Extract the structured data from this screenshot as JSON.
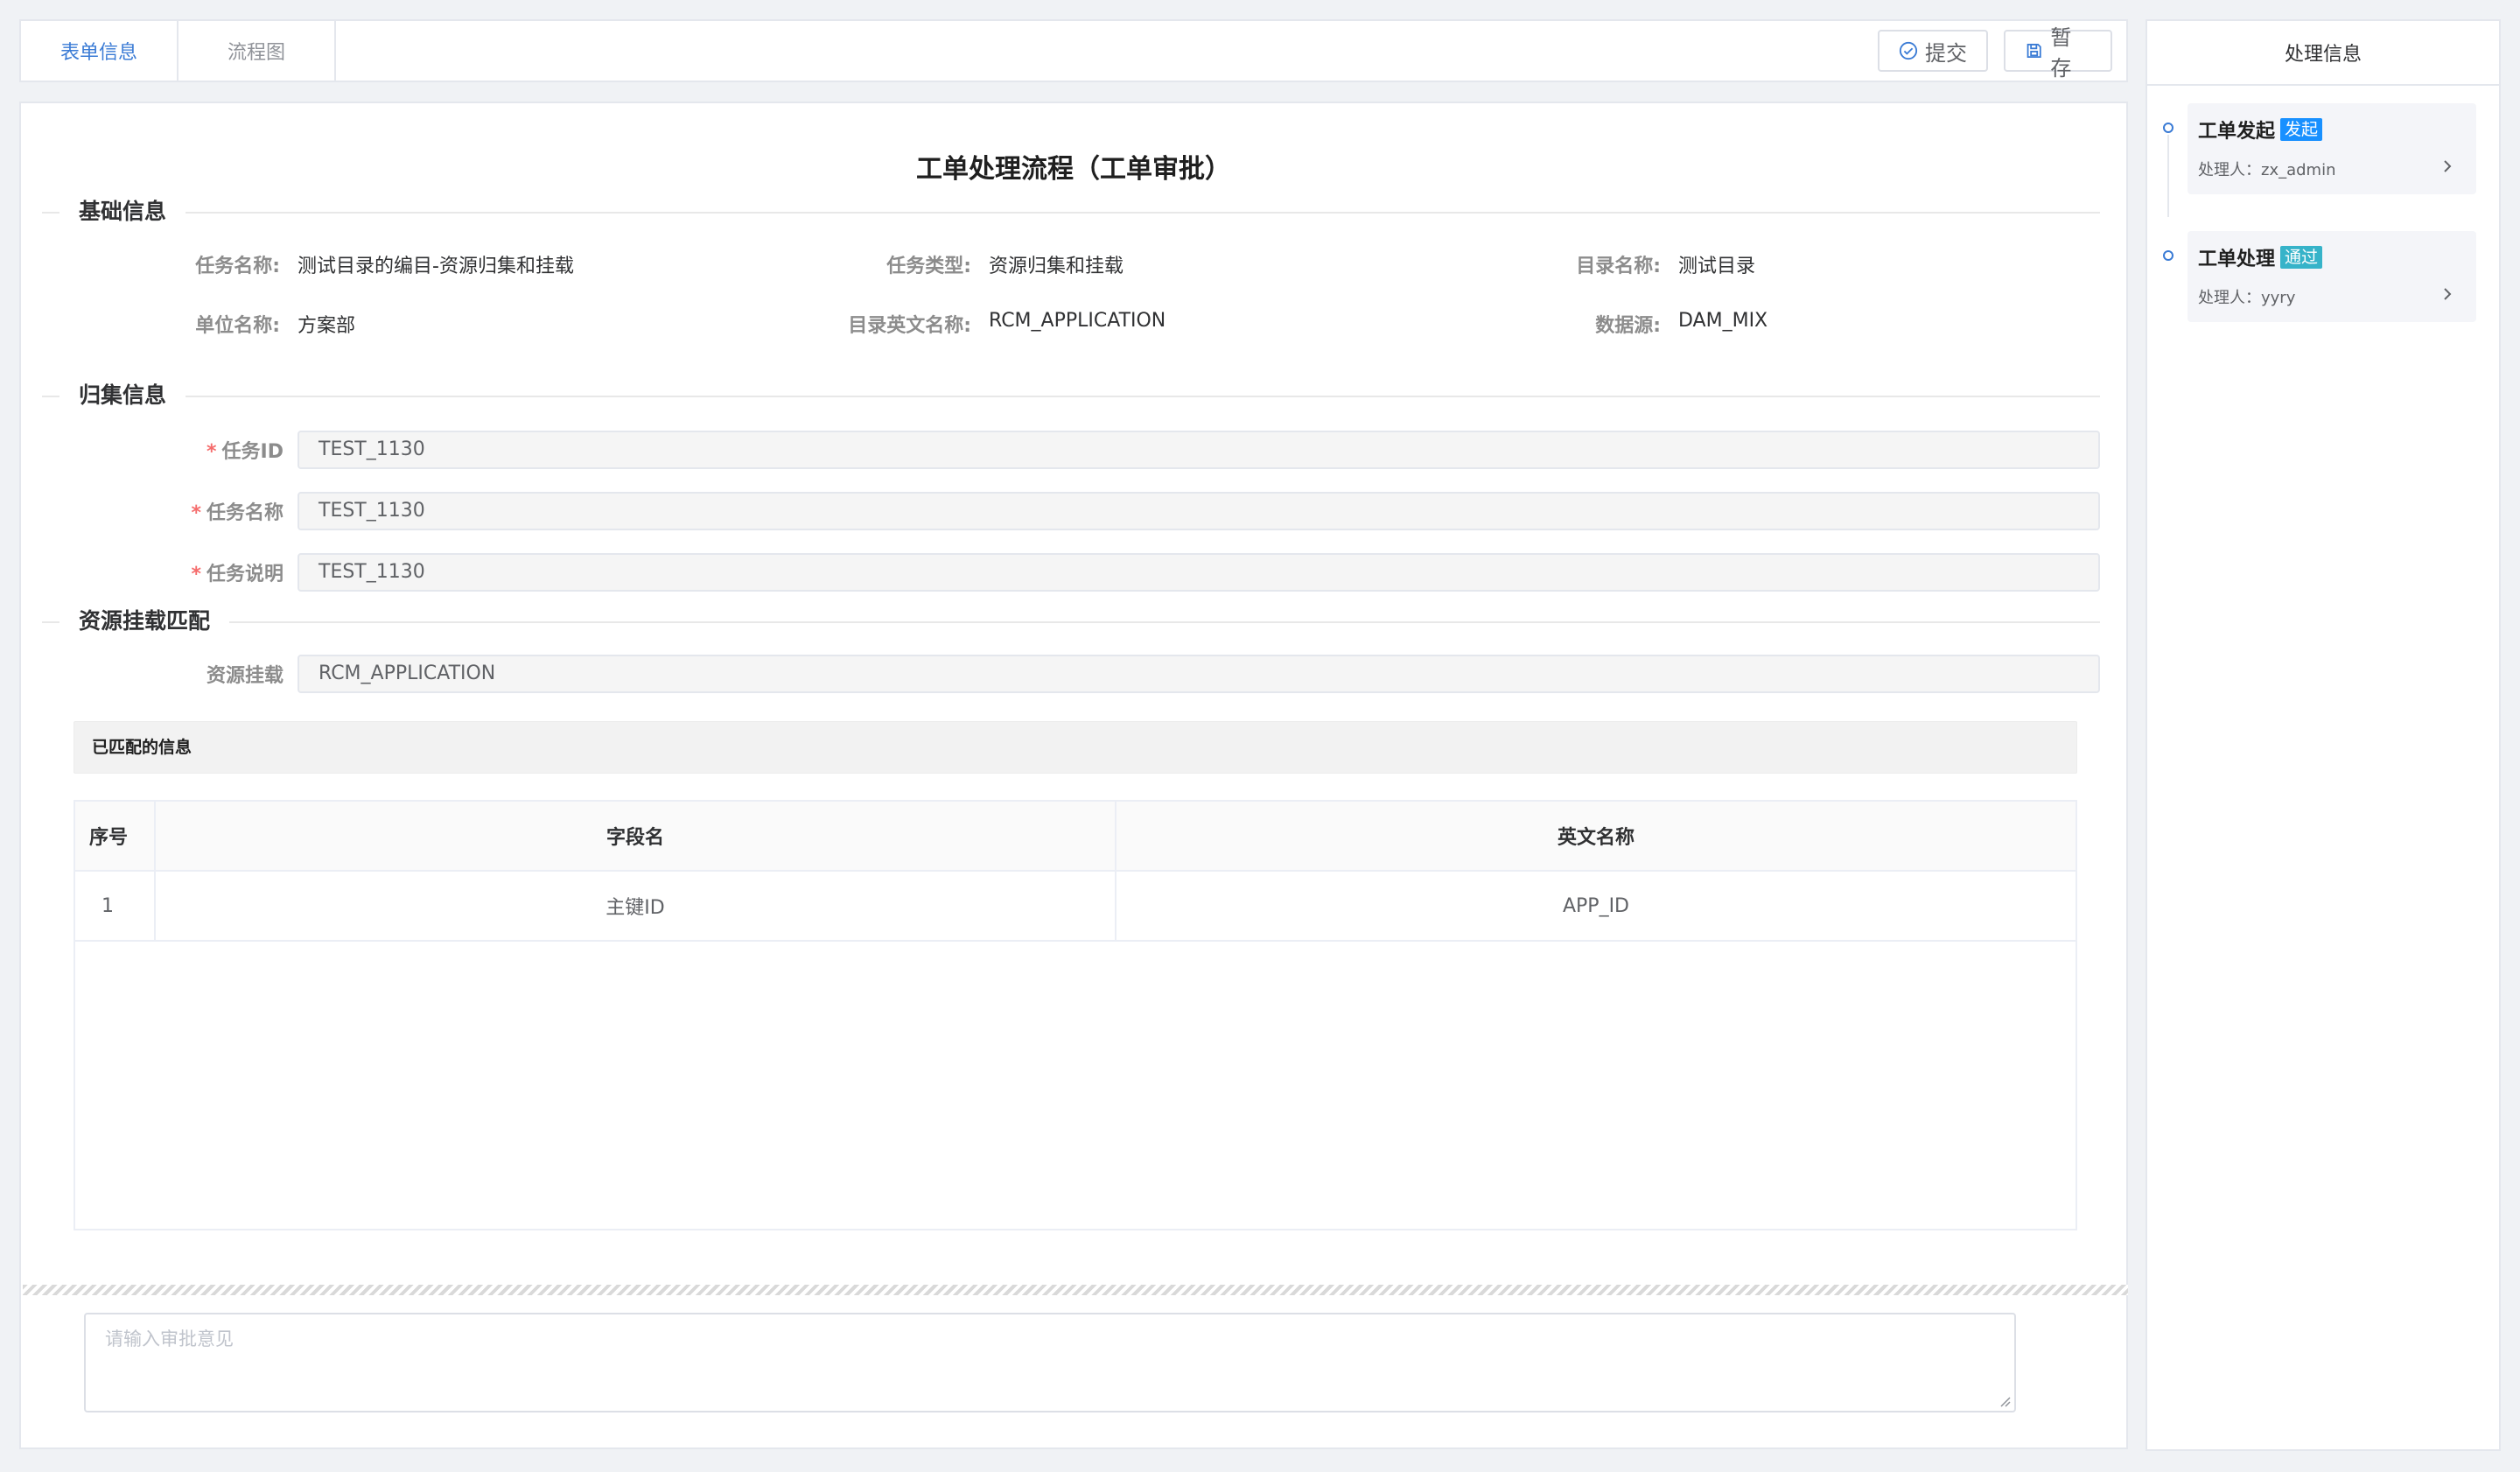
{
  "tabs": [
    {
      "label": "表单信息",
      "active": true
    },
    {
      "label": "流程图",
      "active": false
    }
  ],
  "toolbar": {
    "submit_label": "提交",
    "save_label": "暂存"
  },
  "form": {
    "title": "工单处理流程（工单审批）",
    "basic": {
      "title": "基础信息",
      "task_name_label": "任务名称:",
      "task_name": "测试目录的编目-资源归集和挂载",
      "task_type_label": "任务类型:",
      "task_type": "资源归集和挂载",
      "catalog_name_label": "目录名称:",
      "catalog_name": "测试目录",
      "unit_label": "单位名称:",
      "unit": "方案部",
      "catalog_en_label": "目录英文名称:",
      "catalog_en": "RCM_APPLICATION",
      "datasource_label": "数据源:",
      "datasource": "DAM_MIX"
    },
    "collect": {
      "title": "归集信息",
      "task_id_label": "任务ID",
      "task_id": "TEST_1130",
      "task_name_label": "任务名称",
      "task_name": "TEST_1130",
      "task_desc_label": "任务说明",
      "task_desc": "TEST_1130"
    },
    "mount": {
      "title": "资源挂载匹配",
      "mount_label": "资源挂载",
      "mount_value": "RCM_APPLICATION",
      "matched_title": "已匹配的信息",
      "columns": [
        "序号",
        "字段名",
        "英文名称"
      ],
      "rows": [
        {
          "no": "1",
          "field": "主键ID",
          "en": "APP_ID"
        }
      ]
    },
    "opinion_placeholder": "请输入审批意见"
  },
  "side": {
    "title": "处理信息",
    "steps": [
      {
        "title": "工单发起",
        "badge": "发起",
        "badge_color": "#1890ff",
        "handler": "处理人：zx_admin"
      },
      {
        "title": "工单处理",
        "badge": "通过",
        "badge_color": "#36b3c9",
        "handler": "处理人：yyry"
      }
    ]
  },
  "colors": {
    "accent": "#3a7bd5",
    "required": "#f56c6c"
  }
}
